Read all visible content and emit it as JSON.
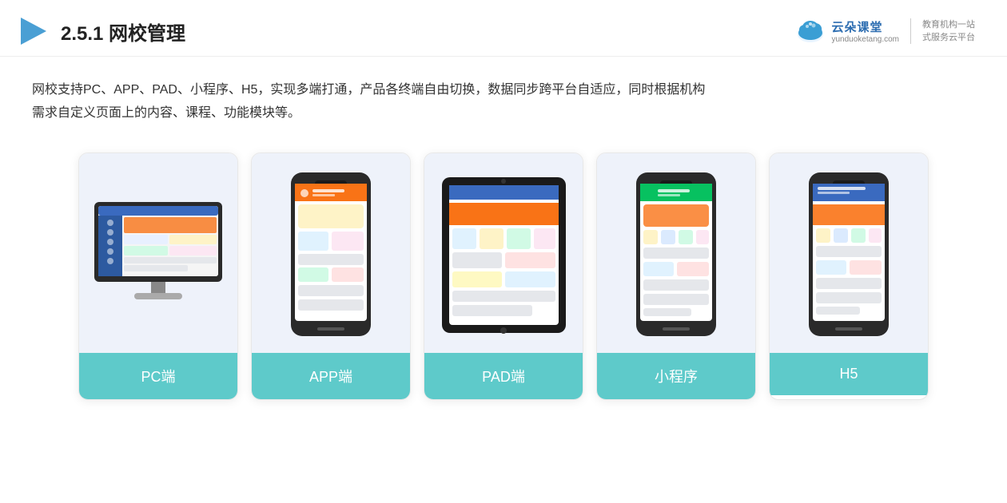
{
  "header": {
    "title_prefix": "2.5.1 ",
    "title_bold": "网校管理",
    "logo_name": "云朵课堂",
    "logo_url": "yunduoketang.com",
    "logo_divider_text": "",
    "logo_slogan_line1": "教育机构一站",
    "logo_slogan_line2": "式服务云平台"
  },
  "description": {
    "line1": "网校支持PC、APP、PAD、小程序、H5，实现多端打通，产品各终端自由切换，数据同步跨平台自适应，同时根据机构",
    "line2": "需求自定义页面上的内容、课程、功能模块等。"
  },
  "cards": [
    {
      "id": "pc",
      "label": "PC端",
      "type": "pc"
    },
    {
      "id": "app",
      "label": "APP端",
      "type": "phone"
    },
    {
      "id": "pad",
      "label": "PAD端",
      "type": "tablet"
    },
    {
      "id": "miniapp",
      "label": "小程序",
      "type": "phone"
    },
    {
      "id": "h5",
      "label": "H5",
      "type": "phone"
    }
  ],
  "colors": {
    "accent_teal": "#5ecaca",
    "card_bg": "#eef2fa",
    "text_dark": "#333",
    "header_blue": "#2b6cb0"
  }
}
